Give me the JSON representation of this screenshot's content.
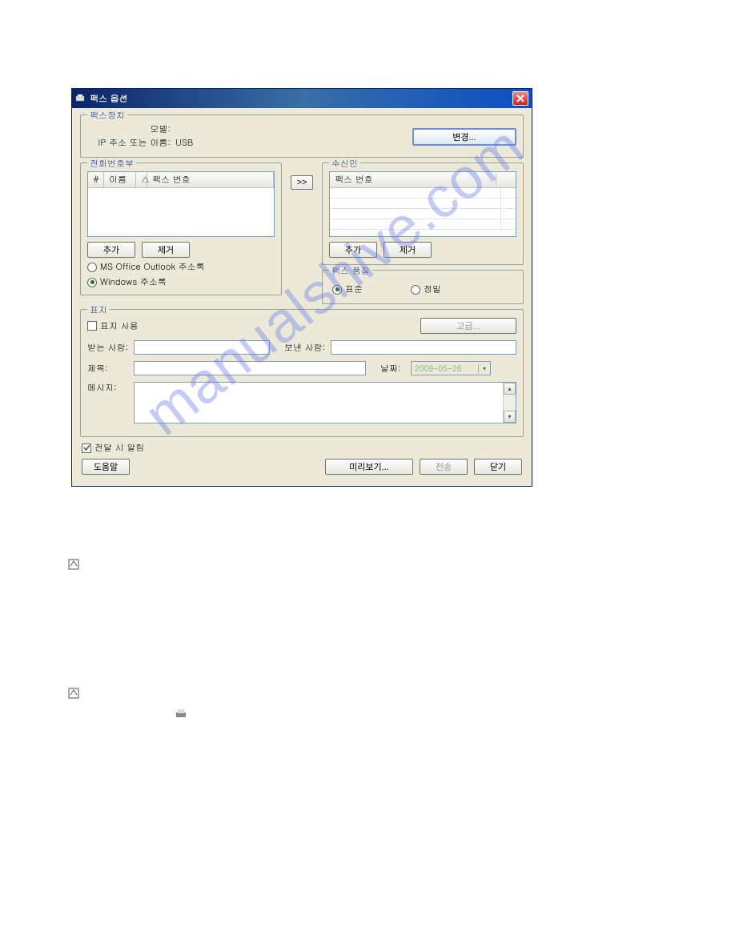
{
  "dialog": {
    "title": "팩스 옵션",
    "device": {
      "legend": "팩스장치",
      "model_label": "모델:",
      "model_value": "",
      "ip_label": "IP 주소 또는 이름:",
      "ip_value": "USB",
      "change_btn": "변경..."
    },
    "phonebook": {
      "legend": "전화번호부",
      "col_hash": "#",
      "col_name": "이름",
      "col_sort": "△",
      "col_faxno": "팩스 번호",
      "add_btn": "추가",
      "remove_btn": "제거",
      "radio_outlook": "MS Office Outlook 주소록",
      "radio_windows": "Windows 주소록"
    },
    "transfer_btn": ">>",
    "recipient": {
      "legend": "수신인",
      "col_faxno": "팩스 번호",
      "add_btn": "추가",
      "remove_btn": "제거"
    },
    "quality": {
      "legend": "팩스 품질",
      "standard": "표준",
      "fine": "정밀"
    },
    "cover": {
      "legend": "표지",
      "use_cover": "표지 사용",
      "advanced_btn": "고급...",
      "to_label": "받는 사람:",
      "from_label": "보낸 사람:",
      "subject_label": "제목:",
      "date_label": "날짜:",
      "date_value": "2009-05-26",
      "message_label": "메시지:"
    },
    "notify_label": "전달 시 알림",
    "buttons": {
      "help": "도움말",
      "preview": "미리보기...",
      "send": "전송",
      "close": "닫기"
    }
  },
  "watermark": "manualshive.com"
}
